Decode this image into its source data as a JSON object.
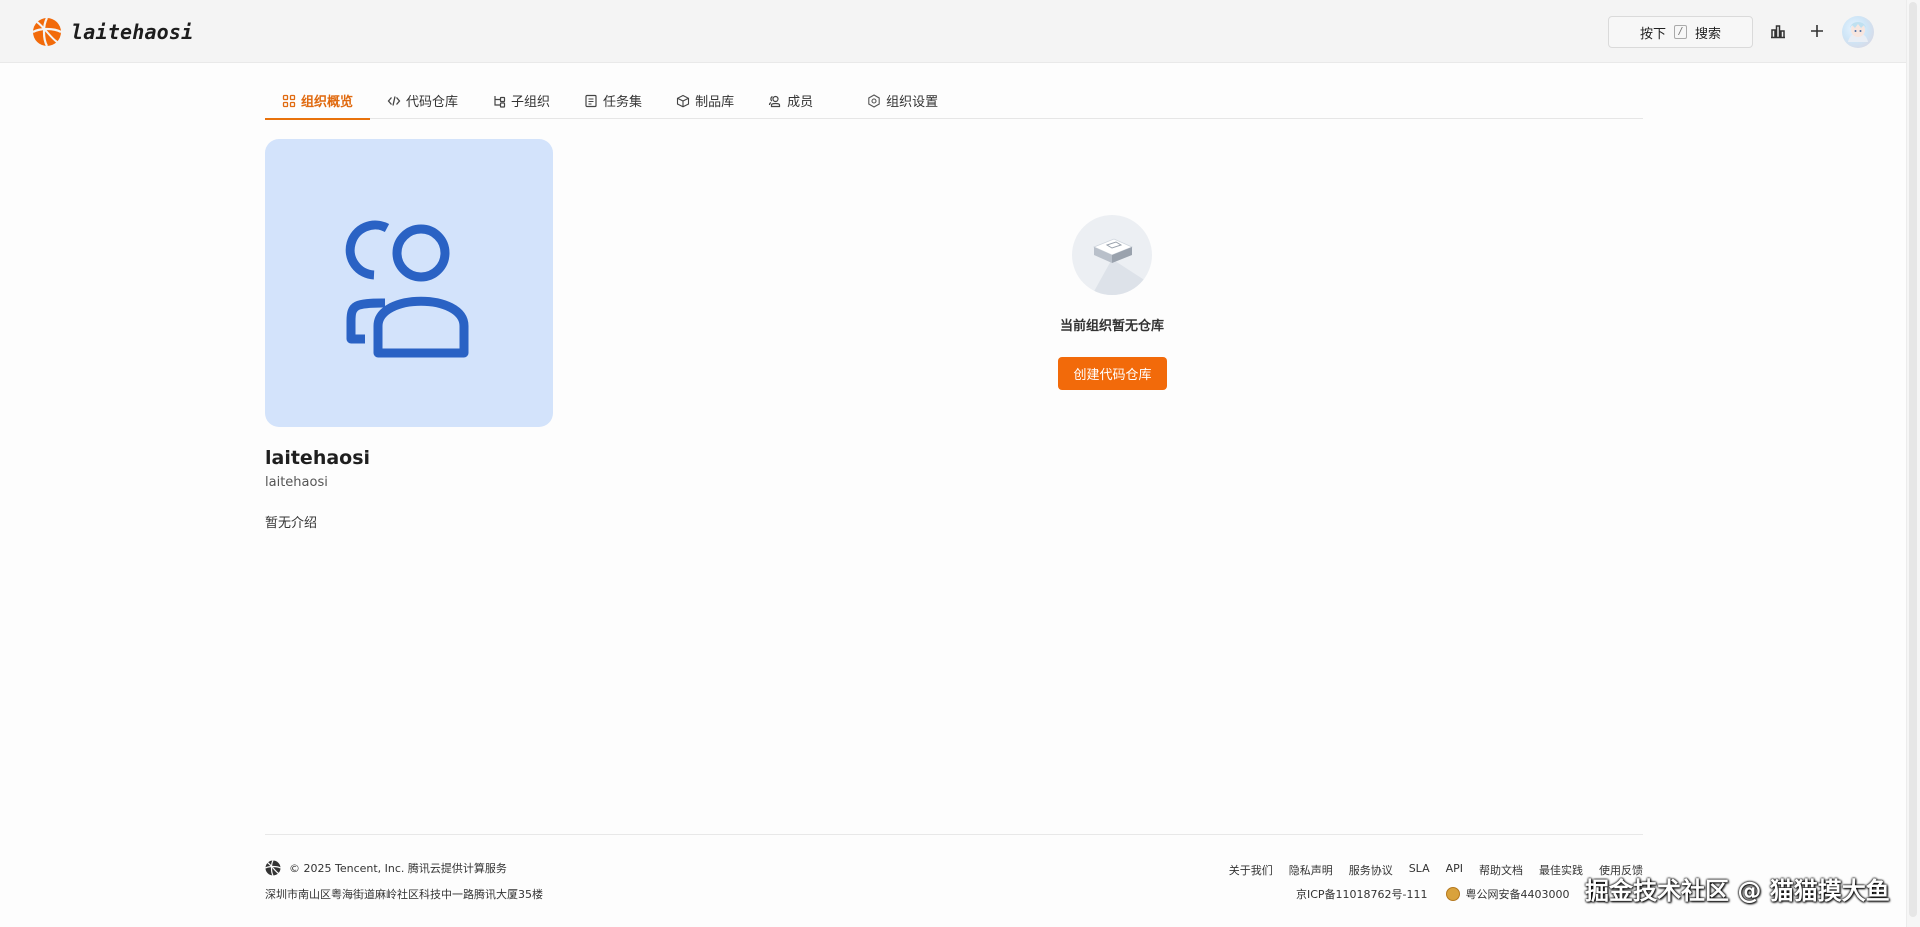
{
  "header": {
    "brand": "laitehaosi",
    "search_key": "按下",
    "search_kbd": "/",
    "search_label": "搜索"
  },
  "tabs": [
    {
      "label": "组织概览",
      "active": true
    },
    {
      "label": "代码仓库",
      "active": false
    },
    {
      "label": "子组织",
      "active": false
    },
    {
      "label": "任务集",
      "active": false
    },
    {
      "label": "制品库",
      "active": false
    },
    {
      "label": "成员",
      "active": false
    },
    {
      "label": "组织设置",
      "active": false
    }
  ],
  "org": {
    "name": "laitehaosi",
    "slug": "laitehaosi",
    "description": "暂无介绍"
  },
  "empty_state": {
    "message": "当前组织暂无仓库",
    "button": "创建代码仓库"
  },
  "footer": {
    "copyright": "© 2025 Tencent, Inc. 腾讯云提供计算服务",
    "address": "深圳市南山区粤海街道麻岭社区科技中一路腾讯大厦35楼",
    "links": [
      "关于我们",
      "隐私声明",
      "服务协议",
      "SLA",
      "API",
      "帮助文档",
      "最佳实践",
      "使用反馈"
    ],
    "icp": "京ICP备11018762号-111",
    "police": "粤公网安备4403000",
    "watermark": "掘金技术社区 @ 猫猫摸大鱼"
  },
  "colors": {
    "accent": "#f26a0a",
    "tab_active": "#e06a10",
    "org_avatar_bg": "#d3e3fb",
    "org_avatar_icon": "#2a62c4"
  }
}
